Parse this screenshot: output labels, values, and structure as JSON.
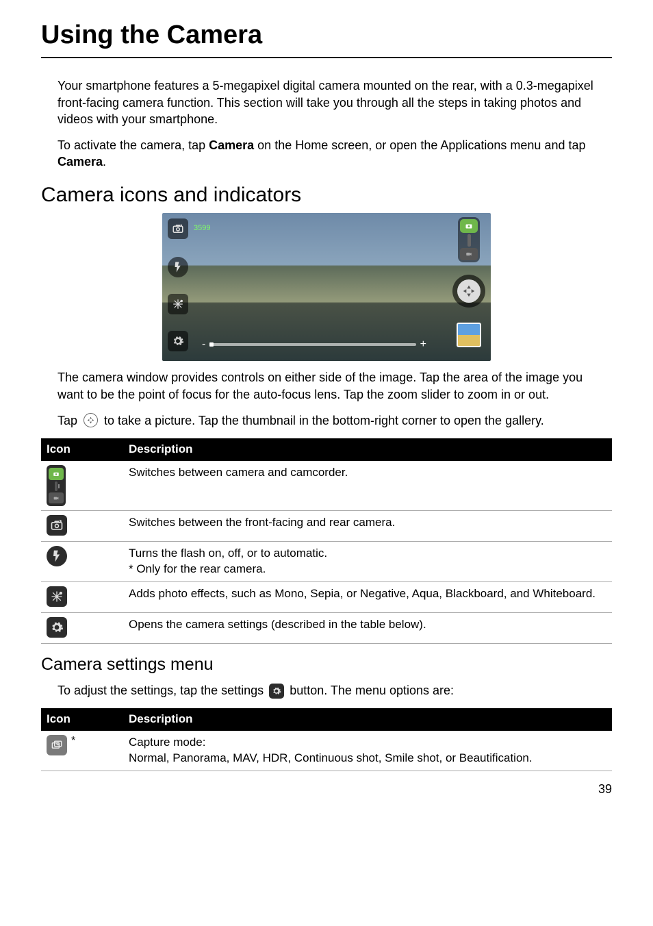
{
  "title": "Using the Camera",
  "intro": "Your smartphone features a 5-megapixel digital camera mounted on the rear, with a 0.3-megapixel front-facing camera function. This section will take you through all the steps in taking photos and videos with your smartphone.",
  "activate_pre": "To activate the camera, tap ",
  "activate_b1": "Camera",
  "activate_mid": " on the Home screen, or open the Applications menu and tap ",
  "activate_b2": "Camera",
  "activate_end": ".",
  "icons_heading": "Camera icons and indicators",
  "screenshot": {
    "count": "3599",
    "zoom_minus": "-",
    "zoom_plus": "+"
  },
  "window_para": "The camera window provides controls on either side of the image. Tap the area of the image you want to be the point of focus for the auto-focus lens. Tap the zoom slider to zoom in or out.",
  "tap_pre": "Tap ",
  "tap_mid": " to take a picture. Tap the thumbnail in the bottom-right corner to open the gallery.",
  "table1": {
    "h_icon": "Icon",
    "h_desc": "Description",
    "r1": "Switches between camera and camcorder.",
    "r2": "Switches between the front-facing and rear camera.",
    "r3a": "Turns the flash on, off, or to automatic.",
    "r3b": "* Only for the rear camera.",
    "r4": "Adds photo effects, such as Mono, Sepia, or Negative, Aqua, Blackboard, and Whiteboard.",
    "r5": "Opens the camera settings (described in the table below)."
  },
  "settings_heading": "Camera settings menu",
  "settings_intro_pre": "To adjust the settings, tap the settings ",
  "settings_intro_post": " button. The menu options are:",
  "table2": {
    "h_icon": "Icon",
    "h_desc": "Description",
    "r1a": "Capture mode:",
    "r1b": "Normal, Panorama, MAV, HDR, Continuous shot, Smile shot, or Beautification.",
    "asterisk": "*"
  },
  "page_number": "39"
}
